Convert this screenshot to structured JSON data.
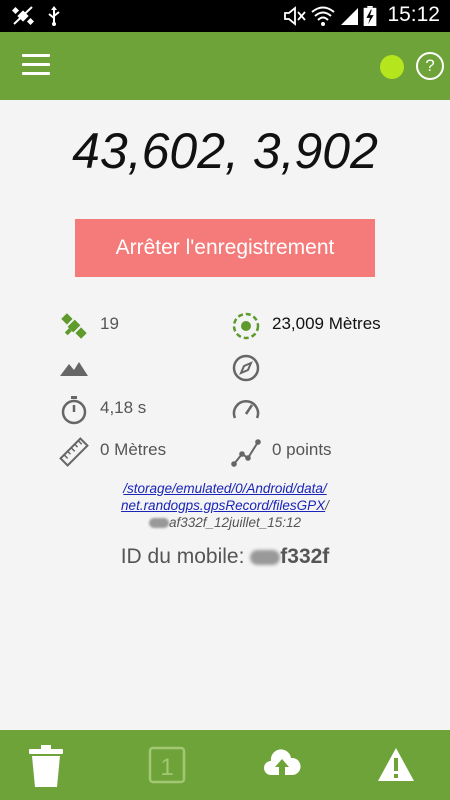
{
  "status_bar": {
    "time": "15:12",
    "icons": [
      "satellite-off-icon",
      "usb-icon",
      "mute-icon",
      "wifi-icon",
      "signal-icon",
      "battery-charging-icon"
    ]
  },
  "app_bar": {
    "menu_icon": "hamburger-menu-icon",
    "gps_indicator_color": "#b5e61d",
    "help_label": "?"
  },
  "main": {
    "coordinates": "43,602, 3,902",
    "stop_button_label": "Arrêter l'enregistrement",
    "stats": {
      "satellites": "19",
      "accuracy": "23,009 Mètres",
      "altitude": "",
      "bearing": "",
      "interval": "4,18 s",
      "speed": "",
      "distance": "0 Mètres",
      "points": "0 points"
    },
    "file_path": {
      "line1": "/storage/emulated/0/Android/data/",
      "line2_link": "net.randogps.gpsRecord/filesGPX",
      "line2_sep": "/",
      "line3_suffix": "af332f_12juillet_15:12"
    },
    "device_id_label": "ID du mobile:",
    "device_id_value": "f332f"
  },
  "bottom_bar": {
    "buttons": [
      "trash-icon",
      "counter-icon",
      "cloud-upload-icon",
      "warning-icon"
    ],
    "counter_value": "1"
  },
  "colors": {
    "primary": "#6ea33a",
    "stop_button": "#f57a7a",
    "icon_green": "#5e9a2c",
    "link": "#1a24b8"
  }
}
